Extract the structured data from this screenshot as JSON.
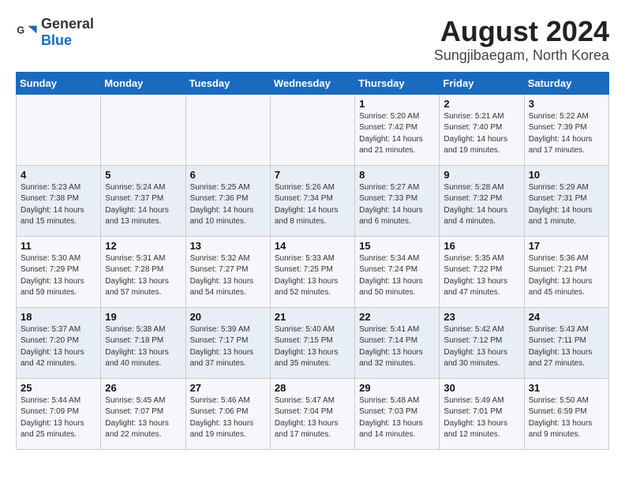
{
  "logo": {
    "text_general": "General",
    "text_blue": "Blue"
  },
  "title": {
    "month_year": "August 2024",
    "location": "Sungjibaegam, North Korea"
  },
  "headers": [
    "Sunday",
    "Monday",
    "Tuesday",
    "Wednesday",
    "Thursday",
    "Friday",
    "Saturday"
  ],
  "weeks": [
    [
      {
        "day": "",
        "info": ""
      },
      {
        "day": "",
        "info": ""
      },
      {
        "day": "",
        "info": ""
      },
      {
        "day": "",
        "info": ""
      },
      {
        "day": "1",
        "info": "Sunrise: 5:20 AM\nSunset: 7:42 PM\nDaylight: 14 hours\nand 21 minutes."
      },
      {
        "day": "2",
        "info": "Sunrise: 5:21 AM\nSunset: 7:40 PM\nDaylight: 14 hours\nand 19 minutes."
      },
      {
        "day": "3",
        "info": "Sunrise: 5:22 AM\nSunset: 7:39 PM\nDaylight: 14 hours\nand 17 minutes."
      }
    ],
    [
      {
        "day": "4",
        "info": "Sunrise: 5:23 AM\nSunset: 7:38 PM\nDaylight: 14 hours\nand 15 minutes."
      },
      {
        "day": "5",
        "info": "Sunrise: 5:24 AM\nSunset: 7:37 PM\nDaylight: 14 hours\nand 13 minutes."
      },
      {
        "day": "6",
        "info": "Sunrise: 5:25 AM\nSunset: 7:36 PM\nDaylight: 14 hours\nand 10 minutes."
      },
      {
        "day": "7",
        "info": "Sunrise: 5:26 AM\nSunset: 7:34 PM\nDaylight: 14 hours\nand 8 minutes."
      },
      {
        "day": "8",
        "info": "Sunrise: 5:27 AM\nSunset: 7:33 PM\nDaylight: 14 hours\nand 6 minutes."
      },
      {
        "day": "9",
        "info": "Sunrise: 5:28 AM\nSunset: 7:32 PM\nDaylight: 14 hours\nand 4 minutes."
      },
      {
        "day": "10",
        "info": "Sunrise: 5:29 AM\nSunset: 7:31 PM\nDaylight: 14 hours\nand 1 minute."
      }
    ],
    [
      {
        "day": "11",
        "info": "Sunrise: 5:30 AM\nSunset: 7:29 PM\nDaylight: 13 hours\nand 59 minutes."
      },
      {
        "day": "12",
        "info": "Sunrise: 5:31 AM\nSunset: 7:28 PM\nDaylight: 13 hours\nand 57 minutes."
      },
      {
        "day": "13",
        "info": "Sunrise: 5:32 AM\nSunset: 7:27 PM\nDaylight: 13 hours\nand 54 minutes."
      },
      {
        "day": "14",
        "info": "Sunrise: 5:33 AM\nSunset: 7:25 PM\nDaylight: 13 hours\nand 52 minutes."
      },
      {
        "day": "15",
        "info": "Sunrise: 5:34 AM\nSunset: 7:24 PM\nDaylight: 13 hours\nand 50 minutes."
      },
      {
        "day": "16",
        "info": "Sunrise: 5:35 AM\nSunset: 7:22 PM\nDaylight: 13 hours\nand 47 minutes."
      },
      {
        "day": "17",
        "info": "Sunrise: 5:36 AM\nSunset: 7:21 PM\nDaylight: 13 hours\nand 45 minutes."
      }
    ],
    [
      {
        "day": "18",
        "info": "Sunrise: 5:37 AM\nSunset: 7:20 PM\nDaylight: 13 hours\nand 42 minutes."
      },
      {
        "day": "19",
        "info": "Sunrise: 5:38 AM\nSunset: 7:18 PM\nDaylight: 13 hours\nand 40 minutes."
      },
      {
        "day": "20",
        "info": "Sunrise: 5:39 AM\nSunset: 7:17 PM\nDaylight: 13 hours\nand 37 minutes."
      },
      {
        "day": "21",
        "info": "Sunrise: 5:40 AM\nSunset: 7:15 PM\nDaylight: 13 hours\nand 35 minutes."
      },
      {
        "day": "22",
        "info": "Sunrise: 5:41 AM\nSunset: 7:14 PM\nDaylight: 13 hours\nand 32 minutes."
      },
      {
        "day": "23",
        "info": "Sunrise: 5:42 AM\nSunset: 7:12 PM\nDaylight: 13 hours\nand 30 minutes."
      },
      {
        "day": "24",
        "info": "Sunrise: 5:43 AM\nSunset: 7:11 PM\nDaylight: 13 hours\nand 27 minutes."
      }
    ],
    [
      {
        "day": "25",
        "info": "Sunrise: 5:44 AM\nSunset: 7:09 PM\nDaylight: 13 hours\nand 25 minutes."
      },
      {
        "day": "26",
        "info": "Sunrise: 5:45 AM\nSunset: 7:07 PM\nDaylight: 13 hours\nand 22 minutes."
      },
      {
        "day": "27",
        "info": "Sunrise: 5:46 AM\nSunset: 7:06 PM\nDaylight: 13 hours\nand 19 minutes."
      },
      {
        "day": "28",
        "info": "Sunrise: 5:47 AM\nSunset: 7:04 PM\nDaylight: 13 hours\nand 17 minutes."
      },
      {
        "day": "29",
        "info": "Sunrise: 5:48 AM\nSunset: 7:03 PM\nDaylight: 13 hours\nand 14 minutes."
      },
      {
        "day": "30",
        "info": "Sunrise: 5:49 AM\nSunset: 7:01 PM\nDaylight: 13 hours\nand 12 minutes."
      },
      {
        "day": "31",
        "info": "Sunrise: 5:50 AM\nSunset: 6:59 PM\nDaylight: 13 hours\nand 9 minutes."
      }
    ]
  ]
}
